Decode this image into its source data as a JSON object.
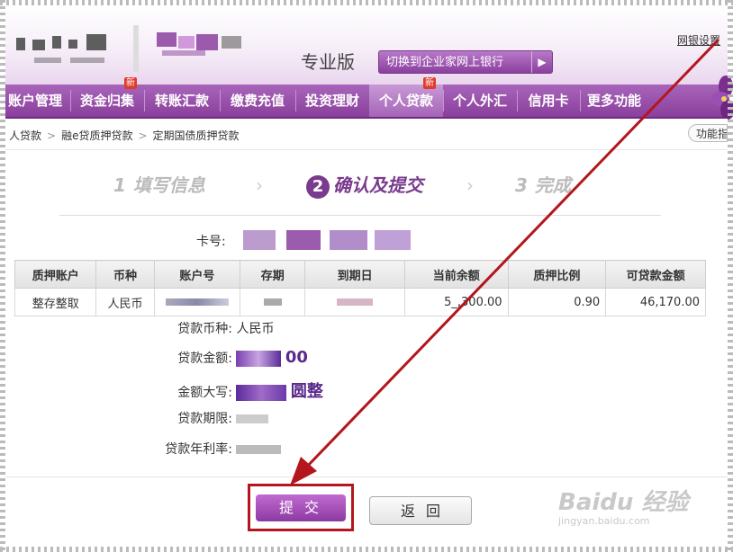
{
  "header": {
    "edition": "专业版",
    "switch_button": "切换到企业家网上银行",
    "net_settings": "网银设置"
  },
  "nav": {
    "items": [
      {
        "label": "账户管理",
        "new": false
      },
      {
        "label": "资金归集",
        "new": true
      },
      {
        "label": "转账汇款",
        "new": false
      },
      {
        "label": "缴费充值",
        "new": false
      },
      {
        "label": "投资理财",
        "new": false
      },
      {
        "label": "个人贷款",
        "new": true
      },
      {
        "label": "个人外汇",
        "new": false
      },
      {
        "label": "信用卡",
        "new": false
      },
      {
        "label": "更多功能",
        "new": false
      }
    ],
    "active_index": 5,
    "new_badge": "新"
  },
  "breadcrumb": {
    "items": [
      "人贷款",
      "融e贷质押贷款",
      "定期国债质押贷款"
    ],
    "separator": ">",
    "func_button": "功能指"
  },
  "steps": {
    "items": [
      {
        "num": "1",
        "label": "填写信息"
      },
      {
        "num": "2",
        "label": "确认及提交"
      },
      {
        "num": "3",
        "label": "完成"
      }
    ],
    "current": 1
  },
  "card": {
    "label": "卡号:"
  },
  "table": {
    "headers": [
      "质押账户",
      "币种",
      "账户号",
      "存期",
      "到期日",
      "当前余额",
      "质押比例",
      "可贷款金额"
    ],
    "rows": [
      [
        "整存整取",
        "人民币",
        "",
        "",
        "",
        "5_,300.00",
        "0.90",
        "46,170.00"
      ]
    ]
  },
  "form": {
    "currency_label": "贷款币种:",
    "currency_value": "人民币",
    "amount_label": "贷款金额:",
    "amount_suffix": "00",
    "amount_cn_label": "金额大写:",
    "amount_cn_suffix": "圆整",
    "term_label": "贷款期限:",
    "rate_label": "贷款年利率:"
  },
  "buttons": {
    "submit": "提交",
    "back": "返回"
  },
  "watermark": {
    "title": "Baidu 经验",
    "url": "jingyan.baidu.com"
  },
  "colors": {
    "brand_purple": "#8a3f9c",
    "annotation_red": "#b3161d"
  }
}
